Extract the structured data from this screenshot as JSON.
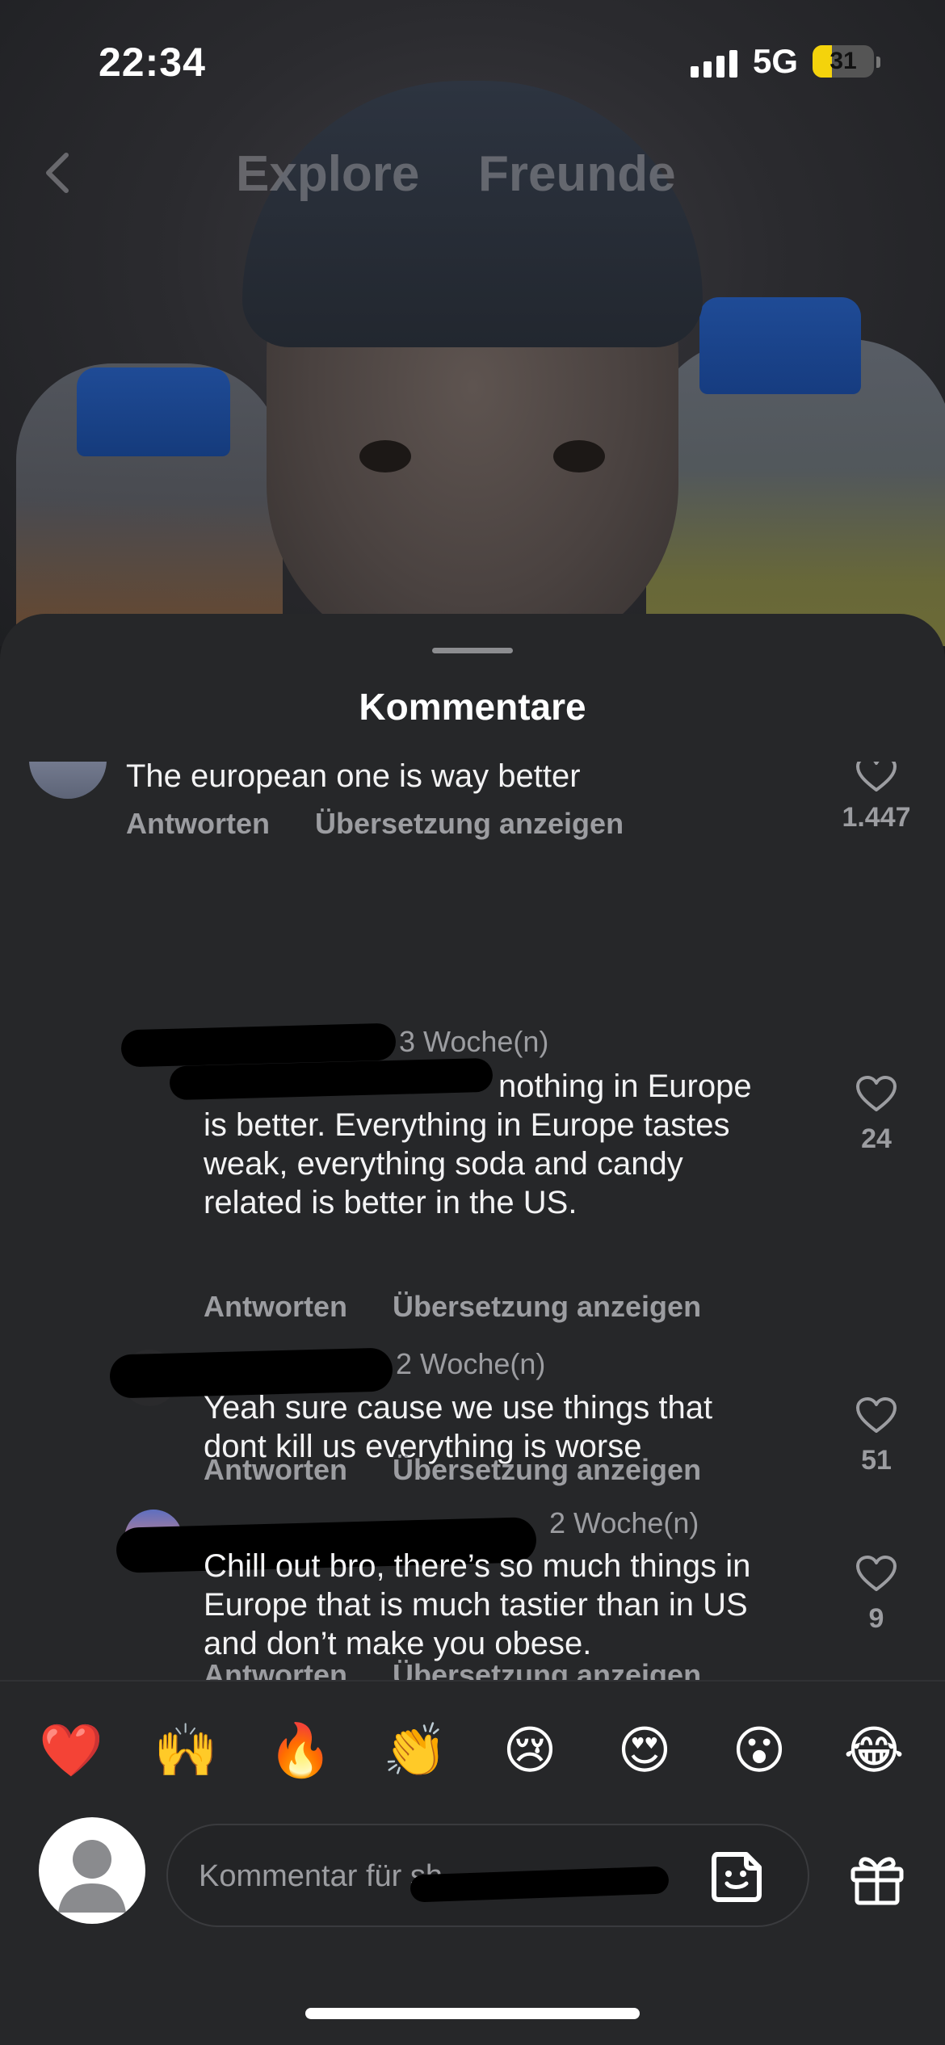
{
  "status_bar": {
    "time": "22:34",
    "network": "5G",
    "battery": "31",
    "battery_level_percent": 31,
    "signal_bars": 4
  },
  "top_nav": {
    "tabs": [
      {
        "label": "Explore"
      },
      {
        "label": "Freunde"
      }
    ],
    "back_icon": "chevron-left-icon"
  },
  "sheet": {
    "title": "Kommentare"
  },
  "comments": [
    {
      "text": "The european one is way better",
      "reply_label": "Antworten",
      "translate_label": "Übersetzung anzeigen",
      "likes": "1.447"
    },
    {
      "age": "3 Woche(n)",
      "mention": "@",
      "text_lines": [
        "nothing in Europe",
        "is better. Everything in Europe tastes",
        "weak, everything soda and candy",
        "related is better in the US."
      ],
      "reply_label": "Antworten",
      "translate_label": "Übersetzung anzeigen",
      "likes": "24"
    },
    {
      "age": "2 Woche(n)",
      "text_lines": [
        "Yeah sure cause we use things that",
        "dont kill us everything is worse"
      ],
      "reply_label": "Antworten",
      "translate_label": "Übersetzung anzeigen",
      "likes": "51"
    },
    {
      "age": "2 Woche(n)",
      "text_lines": [
        "Chill out bro, there’s so much things in",
        "Europe that is much tastier than in US",
        "and don’t make you obese."
      ],
      "reply_label": "Antworten",
      "translate_label": "Übersetzung anzeigen",
      "likes": "9"
    }
  ],
  "emoji_bar": [
    "❤️",
    "🙌",
    "🔥",
    "👏",
    "😢",
    "😍",
    "😮",
    "😂"
  ],
  "input": {
    "placeholder": "Kommentar für sh"
  },
  "icons": {
    "heart": "heart-outline-icon",
    "sticker": "sticker-icon",
    "gift": "gift-icon",
    "avatar": "default-avatar-icon"
  },
  "colors": {
    "sheet_bg": "#262729",
    "muted_text": "#9c9da1",
    "battery_fill": "#f4d30c"
  }
}
